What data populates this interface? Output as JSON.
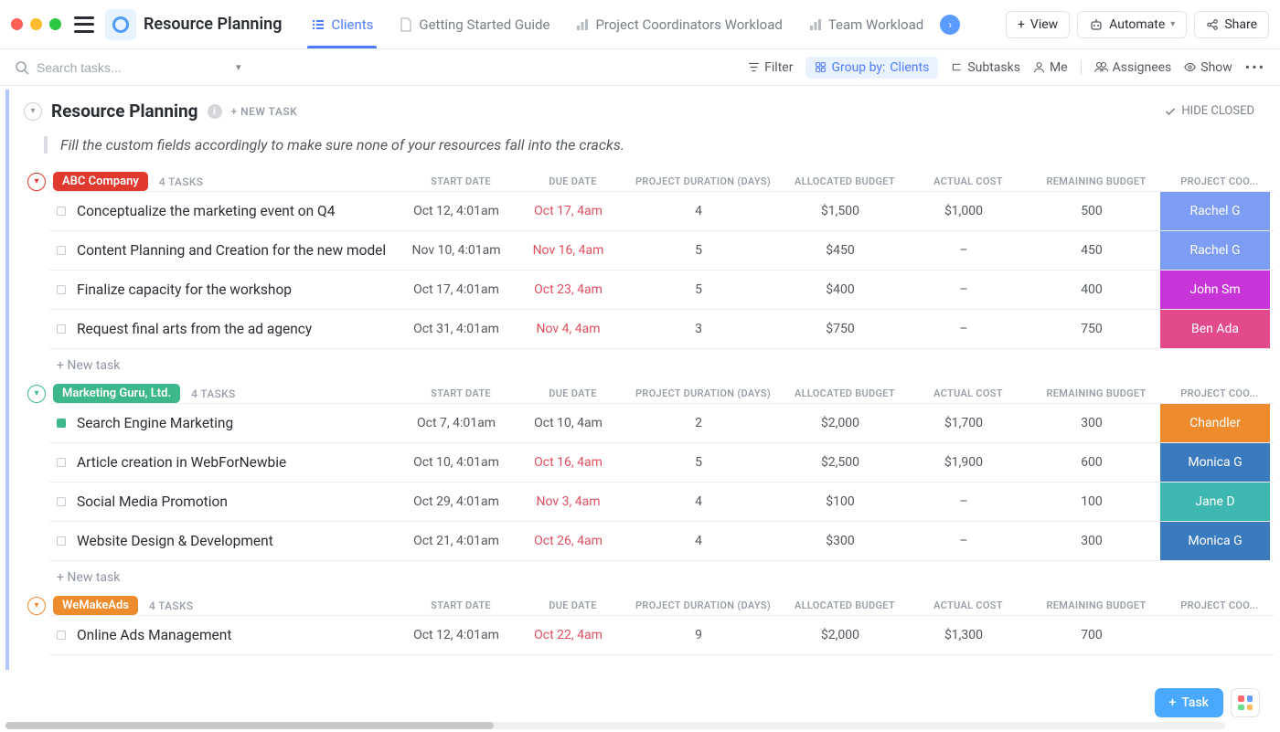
{
  "header": {
    "title": "Resource Planning",
    "tabs": [
      {
        "label": "Clients",
        "active": true
      },
      {
        "label": "Getting Started Guide",
        "active": false
      },
      {
        "label": "Project Coordinators Workload",
        "active": false
      },
      {
        "label": "Team Workload",
        "active": false
      }
    ],
    "actions": {
      "view": "View",
      "automate": "Automate",
      "share": "Share"
    }
  },
  "toolbar": {
    "search_placeholder": "Search tasks...",
    "filter": "Filter",
    "group_by_label": "Group by:",
    "group_by_value": "Clients",
    "subtasks": "Subtasks",
    "me": "Me",
    "assignees": "Assignees",
    "show": "Show"
  },
  "list": {
    "title": "Resource Planning",
    "new_task": "+ NEW TASK",
    "hide_closed": "HIDE CLOSED",
    "instruction": "Fill the custom fields accordingly to make sure none of your resources fall into the cracks.",
    "add_task": "+ New task",
    "columns": [
      "START DATE",
      "DUE DATE",
      "PROJECT DURATION (DAYS)",
      "ALLOCATED BUDGET",
      "ACTUAL COST",
      "REMAINING BUDGET",
      "PROJECT COO..."
    ]
  },
  "groups": [
    {
      "name": "ABC Company",
      "chip_color": "#e0392d",
      "arrow_color": "#e0392d",
      "count": "4 TASKS",
      "rows": [
        {
          "name": "Conceptualize the marketing event on Q4",
          "status": "",
          "start": "Oct 12, 4:01am",
          "due": "Oct 17, 4am",
          "due_red": true,
          "duration": "4",
          "alloc": "$1,500",
          "actual": "$1,000",
          "remain": "500",
          "coord": "Rachel G",
          "coord_color": "#7d9cf3"
        },
        {
          "name": "Content Planning and Creation for the new model",
          "status": "",
          "start": "Nov 10, 4:01am",
          "due": "Nov 16, 4am",
          "due_red": true,
          "duration": "5",
          "alloc": "$450",
          "actual": "–",
          "remain": "450",
          "coord": "Rachel G",
          "coord_color": "#7d9cf3"
        },
        {
          "name": "Finalize capacity for the workshop",
          "status": "",
          "start": "Oct 17, 4:01am",
          "due": "Oct 23, 4am",
          "due_red": true,
          "duration": "5",
          "alloc": "$400",
          "actual": "–",
          "remain": "400",
          "coord": "John Sm",
          "coord_color": "#c735d8"
        },
        {
          "name": "Request final arts from the ad agency",
          "status": "",
          "start": "Oct 31, 4:01am",
          "due": "Nov 4, 4am",
          "due_red": true,
          "duration": "3",
          "alloc": "$750",
          "actual": "–",
          "remain": "750",
          "coord": "Ben Ada",
          "coord_color": "#e24a8b"
        }
      ]
    },
    {
      "name": "Marketing Guru, Ltd.",
      "chip_color": "#3db88b",
      "arrow_color": "#3db88b",
      "count": "4 TASKS",
      "rows": [
        {
          "name": "Search Engine Marketing",
          "status": "green",
          "start": "Oct 7, 4:01am",
          "due": "Oct 10, 4am",
          "due_red": false,
          "duration": "2",
          "alloc": "$2,000",
          "actual": "$1,700",
          "remain": "300",
          "coord": "Chandler",
          "coord_color": "#ee8b2d"
        },
        {
          "name": "Article creation in WebForNewbie",
          "status": "",
          "start": "Oct 10, 4:01am",
          "due": "Oct 16, 4am",
          "due_red": true,
          "duration": "5",
          "alloc": "$2,500",
          "actual": "$1,900",
          "remain": "600",
          "coord": "Monica G",
          "coord_color": "#3a7bbf"
        },
        {
          "name": "Social Media Promotion",
          "status": "",
          "start": "Oct 29, 4:01am",
          "due": "Nov 3, 4am",
          "due_red": true,
          "duration": "4",
          "alloc": "$100",
          "actual": "–",
          "remain": "100",
          "coord": "Jane D",
          "coord_color": "#3fb7b1"
        },
        {
          "name": "Website Design & Development",
          "status": "",
          "start": "Oct 21, 4:01am",
          "due": "Oct 26, 4am",
          "due_red": true,
          "duration": "4",
          "alloc": "$300",
          "actual": "–",
          "remain": "300",
          "coord": "Monica G",
          "coord_color": "#3a7bbf"
        }
      ]
    },
    {
      "name": "WeMakeAds",
      "chip_color": "#ee8b2d",
      "arrow_color": "#ee8b2d",
      "count": "4 TASKS",
      "rows": [
        {
          "name": "Online Ads Management",
          "status": "",
          "start": "Oct 12, 4:01am",
          "due": "Oct 22, 4am",
          "due_red": true,
          "duration": "9",
          "alloc": "$2,000",
          "actual": "$1,300",
          "remain": "700",
          "coord": "",
          "coord_color": ""
        }
      ]
    }
  ],
  "float": {
    "task": "Task"
  }
}
